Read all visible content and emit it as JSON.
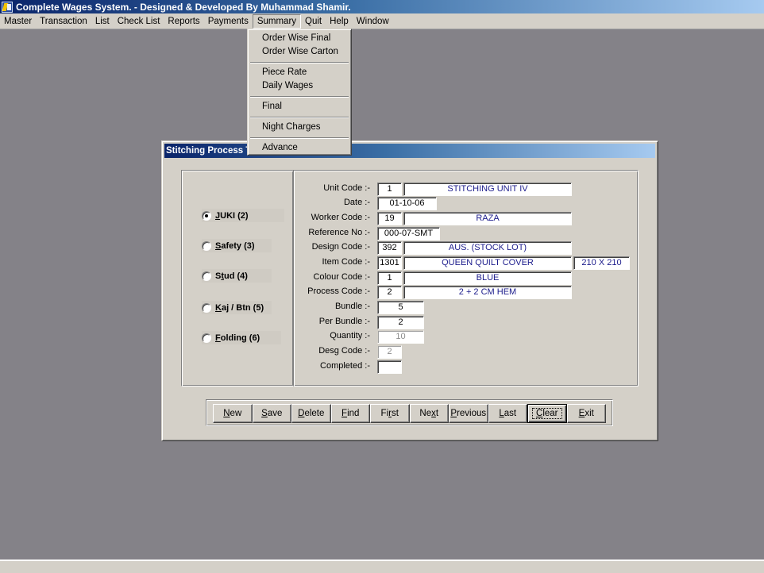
{
  "app": {
    "title": "Complete Wages System. - Designed & Developed By Muhammad Shamir.",
    "icon": "app-lightning-icon"
  },
  "menubar": [
    {
      "label": "Master"
    },
    {
      "label": "Transaction"
    },
    {
      "label": "List"
    },
    {
      "label": "Check List"
    },
    {
      "label": "Reports"
    },
    {
      "label": "Payments"
    },
    {
      "label": "Summary",
      "open": true
    },
    {
      "label": "Quit"
    },
    {
      "label": "Help"
    },
    {
      "label": "Window"
    }
  ],
  "summary_menu": {
    "groups": [
      [
        "Order Wise Final",
        "Order Wise Carton"
      ],
      [
        "Piece Rate",
        "Daily Wages"
      ],
      [
        "Final"
      ],
      [
        "Night Charges"
      ],
      [
        "Advance"
      ]
    ]
  },
  "window": {
    "title": "Stitching Process T",
    "machine_options": [
      {
        "pre": "",
        "ul": "J",
        "post": "UKI (2)",
        "checked": true
      },
      {
        "pre": "",
        "ul": "S",
        "post": "afety (3)",
        "checked": false
      },
      {
        "pre": "S",
        "ul": "t",
        "post": "ud (4)",
        "checked": false
      },
      {
        "pre": "",
        "ul": "K",
        "post": "aj / Btn (5)",
        "checked": false
      },
      {
        "pre": "",
        "ul": "F",
        "post": "olding (6)",
        "checked": false
      }
    ],
    "fields": {
      "unit_code": {
        "label": "Unit Code :-",
        "code": "1",
        "name": "STITCHING UNIT IV"
      },
      "date": {
        "label": "Date :-",
        "value": "01-10-06"
      },
      "worker_code": {
        "label": "Worker Code :-",
        "code": "19",
        "name": "RAZA"
      },
      "reference_no": {
        "label": "Reference No :-",
        "value": "000-07-SMT"
      },
      "design_code": {
        "label": "Design Code :-",
        "code": "392",
        "name": "AUS. (STOCK LOT)"
      },
      "item_code": {
        "label": "Item Code :-",
        "code": "1301",
        "name": "QUEEN QUILT COVER",
        "size": "210 X 210"
      },
      "colour_code": {
        "label": "Colour Code :-",
        "code": "1",
        "name": "BLUE"
      },
      "process_code": {
        "label": "Process Code :-",
        "code": "2",
        "name": "2 + 2 CM HEM"
      },
      "bundle": {
        "label": "Bundle :-",
        "value": "5"
      },
      "per_bundle": {
        "label": "Per Bundle :-",
        "value": "2"
      },
      "quantity": {
        "label": "Quantity :-",
        "value": "10"
      },
      "desg_code": {
        "label": "Desg Code :-",
        "value": "2"
      },
      "completed": {
        "label": "Completed :-",
        "value": ""
      }
    },
    "buttons": [
      {
        "pre": "",
        "ul": "N",
        "post": "ew"
      },
      {
        "pre": "",
        "ul": "S",
        "post": "ave"
      },
      {
        "pre": "",
        "ul": "D",
        "post": "elete"
      },
      {
        "pre": "",
        "ul": "F",
        "post": "ind"
      },
      {
        "pre": "Fi",
        "ul": "r",
        "post": "st"
      },
      {
        "pre": "Ne",
        "ul": "x",
        "post": "t"
      },
      {
        "pre": "",
        "ul": "P",
        "post": "revious"
      },
      {
        "pre": "",
        "ul": "L",
        "post": "ast"
      },
      {
        "pre": "",
        "ul": "C",
        "post": "lear",
        "default": true
      },
      {
        "pre": "",
        "ul": "E",
        "post": "xit"
      }
    ]
  }
}
